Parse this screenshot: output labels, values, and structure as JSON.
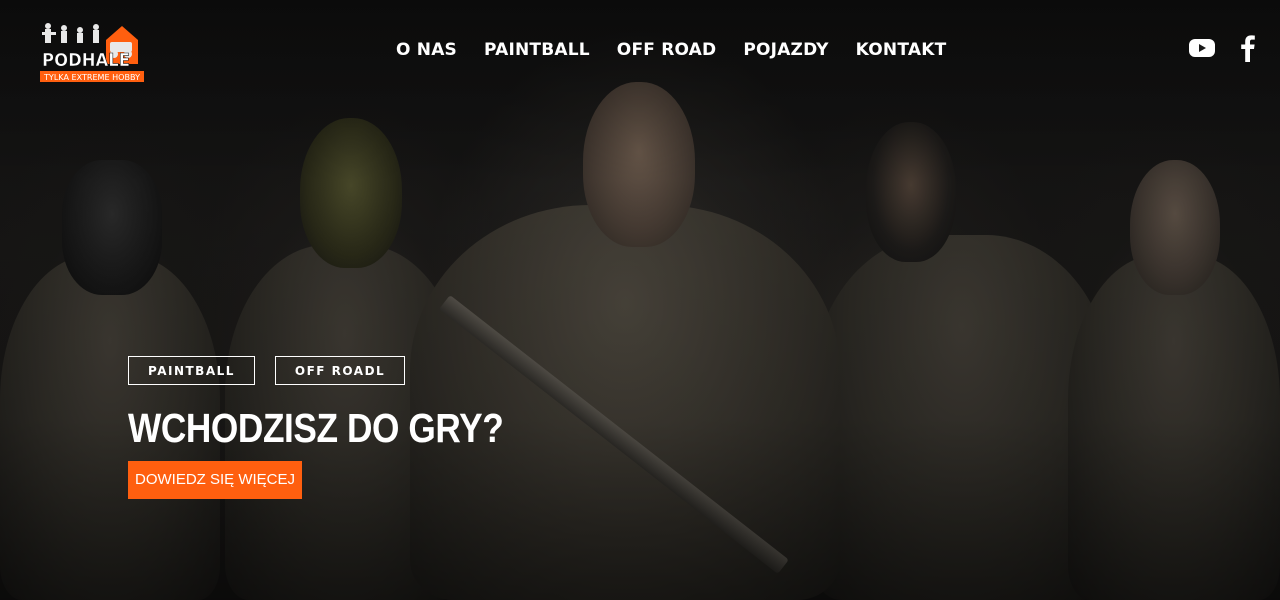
{
  "brand": {
    "name": "PODHALE",
    "tagline": "TYLKA EXTREME HOBBY",
    "accent_color": "#ff5f0f"
  },
  "nav": {
    "items": [
      {
        "label": "O NAS"
      },
      {
        "label": "PAINTBALL"
      },
      {
        "label": "OFF ROAD"
      },
      {
        "label": "POJAZDY"
      },
      {
        "label": "KONTAKT"
      }
    ]
  },
  "social": {
    "icons": [
      "youtube-icon",
      "facebook-icon"
    ]
  },
  "hero": {
    "tags": [
      {
        "label": "PAINTBALL"
      },
      {
        "label": "OFF ROADL"
      }
    ],
    "headline": "WCHODZISZ DO GRY?",
    "cta_label": "DOWIEDZ SIĘ WIĘCEJ"
  }
}
